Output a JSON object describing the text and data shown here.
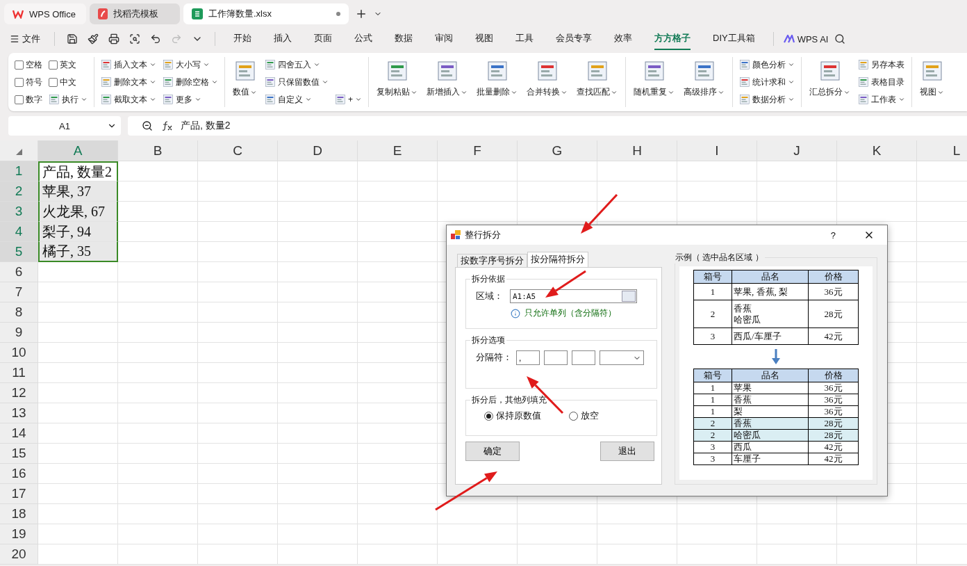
{
  "app_tabs": [
    {
      "kind": "wps",
      "label": "WPS Office",
      "selected": false
    },
    {
      "kind": "template",
      "label": "找稻壳模板",
      "selected": false
    },
    {
      "kind": "sheet",
      "label": "工作簿数量.xlsx",
      "selected": true
    }
  ],
  "menu": {
    "file_label": "文件",
    "tabs": [
      {
        "label": "开始",
        "selected": false
      },
      {
        "label": "插入",
        "selected": false
      },
      {
        "label": "页面",
        "selected": false
      },
      {
        "label": "公式",
        "selected": false
      },
      {
        "label": "数据",
        "selected": false
      },
      {
        "label": "审阅",
        "selected": false
      },
      {
        "label": "视图",
        "selected": false
      },
      {
        "label": "工具",
        "selected": false
      },
      {
        "label": "会员专享",
        "selected": false
      },
      {
        "label": "效率",
        "selected": false
      },
      {
        "label": "方方格子",
        "selected": true
      },
      {
        "label": "DIY工具箱",
        "selected": false
      }
    ],
    "ai_label": "WPS AI"
  },
  "ribbon": {
    "groups": [
      {
        "columns": [
          {
            "items": [
              {
                "kind": "checkbox",
                "label": "空格",
                "checked": false
              },
              {
                "kind": "checkbox",
                "label": "符号",
                "checked": false
              },
              {
                "kind": "checkbox",
                "label": "数字",
                "checked": false
              }
            ]
          },
          {
            "items": [
              {
                "kind": "checkbox",
                "label": "英文",
                "checked": false
              },
              {
                "kind": "checkbox",
                "label": "中文",
                "checked": false
              },
              {
                "kind": "small",
                "label": "执行",
                "dropdown": true
              }
            ]
          }
        ]
      },
      {
        "columns": [
          {
            "items": [
              {
                "kind": "small",
                "label": "插入文本",
                "dropdown": true
              },
              {
                "kind": "small",
                "label": "删除文本",
                "dropdown": true
              },
              {
                "kind": "small",
                "label": "截取文本",
                "dropdown": true
              }
            ]
          },
          {
            "items": [
              {
                "kind": "small",
                "label": "大小写",
                "dropdown": true
              },
              {
                "kind": "small",
                "label": "删除空格",
                "dropdown": true
              },
              {
                "kind": "small",
                "label": "更多",
                "dropdown": true
              }
            ]
          }
        ]
      },
      {
        "columns": [
          {
            "items": [
              {
                "kind": "large",
                "label": "数值",
                "dropdown": true
              }
            ]
          },
          {
            "items": [
              {
                "kind": "small",
                "label": "四舍五入",
                "dropdown": true
              },
              {
                "kind": "small",
                "label": "只保留数值",
                "dropdown": true
              },
              {
                "kind": "small",
                "label": "自定义",
                "dropdown": true
              }
            ]
          },
          {
            "items": [
              {
                "kind": "small",
                "label": "+",
                "dropdown": true
              }
            ]
          }
        ]
      },
      {
        "columns": [
          {
            "items": [
              {
                "kind": "large",
                "label": "复制粘贴",
                "dropdown": true
              }
            ]
          },
          {
            "items": [
              {
                "kind": "large",
                "label": "新增插入",
                "dropdown": true
              }
            ]
          },
          {
            "items": [
              {
                "kind": "large",
                "label": "批量删除",
                "dropdown": true
              }
            ]
          },
          {
            "items": [
              {
                "kind": "large",
                "label": "合并转换",
                "dropdown": true
              }
            ]
          },
          {
            "items": [
              {
                "kind": "large",
                "label": "查找匹配",
                "dropdown": true
              }
            ]
          }
        ]
      },
      {
        "columns": [
          {
            "items": [
              {
                "kind": "large",
                "label": "随机重复",
                "dropdown": true
              }
            ]
          },
          {
            "items": [
              {
                "kind": "large",
                "label": "高级排序",
                "dropdown": true
              }
            ]
          }
        ]
      },
      {
        "columns": [
          {
            "items": [
              {
                "kind": "small",
                "label": "颜色分析",
                "dropdown": true
              },
              {
                "kind": "small",
                "label": "统计求和",
                "dropdown": true
              },
              {
                "kind": "small",
                "label": "数据分析",
                "dropdown": true
              }
            ]
          }
        ]
      },
      {
        "columns": [
          {
            "items": [
              {
                "kind": "large",
                "label": "汇总拆分",
                "dropdown": true
              }
            ]
          },
          {
            "items": [
              {
                "kind": "small",
                "label": "另存本表",
                "dropdown": false
              },
              {
                "kind": "small",
                "label": "表格目录",
                "dropdown": false
              },
              {
                "kind": "small",
                "label": "工作表",
                "dropdown": true
              }
            ]
          }
        ]
      },
      {
        "columns": [
          {
            "items": [
              {
                "kind": "large",
                "label": "视图",
                "dropdown": true
              }
            ]
          }
        ]
      }
    ]
  },
  "formula_bar": {
    "name_box": "A1",
    "formula": "产品, 数量2"
  },
  "sheet": {
    "columns": [
      {
        "label": "A",
        "selected": true
      },
      {
        "label": "B",
        "selected": false
      },
      {
        "label": "C",
        "selected": false
      },
      {
        "label": "D",
        "selected": false
      },
      {
        "label": "E",
        "selected": false
      },
      {
        "label": "F",
        "selected": false
      },
      {
        "label": "G",
        "selected": false
      },
      {
        "label": "H",
        "selected": false
      },
      {
        "label": "I",
        "selected": false
      },
      {
        "label": "J",
        "selected": false
      },
      {
        "label": "K",
        "selected": false
      },
      {
        "label": "L",
        "selected": false
      }
    ],
    "rows": [
      {
        "label": "1",
        "selected": true,
        "cells": [
          {
            "text": "产品, 数量2",
            "selected": true,
            "active": true
          }
        ]
      },
      {
        "label": "2",
        "selected": true,
        "cells": [
          {
            "text": "苹果, 37",
            "selected": true,
            "active": false
          }
        ]
      },
      {
        "label": "3",
        "selected": true,
        "cells": [
          {
            "text": "火龙果, 67",
            "selected": true,
            "active": false
          }
        ]
      },
      {
        "label": "4",
        "selected": true,
        "cells": [
          {
            "text": "梨子, 94",
            "selected": true,
            "active": false
          }
        ]
      },
      {
        "label": "5",
        "selected": true,
        "cells": [
          {
            "text": "橘子, 35",
            "selected": true,
            "active": false
          }
        ]
      },
      {
        "label": "6",
        "selected": false
      },
      {
        "label": "7",
        "selected": false
      },
      {
        "label": "8",
        "selected": false
      },
      {
        "label": "9",
        "selected": false
      },
      {
        "label": "10",
        "selected": false
      },
      {
        "label": "11",
        "selected": false
      },
      {
        "label": "12",
        "selected": false
      },
      {
        "label": "13",
        "selected": false
      },
      {
        "label": "14",
        "selected": false
      },
      {
        "label": "15",
        "selected": false
      },
      {
        "label": "16",
        "selected": false
      },
      {
        "label": "17",
        "selected": false
      },
      {
        "label": "18",
        "selected": false
      },
      {
        "label": "19",
        "selected": false
      },
      {
        "label": "20",
        "selected": false
      }
    ]
  },
  "dialog": {
    "title": "整行拆分",
    "help": "?",
    "tabs": [
      {
        "label": "按数字序号拆分",
        "selected": false
      },
      {
        "label": "按分隔符拆分",
        "selected": true
      }
    ],
    "basis": {
      "legend": "拆分依据",
      "label": "区域：",
      "value": "A1:A5",
      "info": "只允许单列（含分隔符）"
    },
    "options": {
      "legend": "拆分选项",
      "label": "分隔符：",
      "separator": ","
    },
    "fill": {
      "legend": "拆分后，其他列填充",
      "radios": [
        {
          "label": "保持原数值",
          "selected": true
        },
        {
          "label": "放空",
          "selected": false
        }
      ]
    },
    "buttons": [
      "确定",
      "退出"
    ],
    "example": {
      "legend": "示例（ 选中品名区域 ）",
      "before_columns": [
        "箱号",
        "品名",
        "价格"
      ],
      "before": [
        {
          "cells": [
            [
              "1"
            ],
            [
              "苹果, 香蕉, 梨"
            ],
            [
              "36元"
            ]
          ]
        },
        {
          "cells": [
            [
              "2"
            ],
            [
              "香蕉",
              "哈密瓜"
            ],
            [
              "28元"
            ]
          ]
        },
        {
          "cells": [
            [
              "3"
            ],
            [
              "西瓜/车厘子"
            ],
            [
              "42元"
            ]
          ]
        }
      ],
      "after_columns": [
        "箱号",
        "品名",
        "价格"
      ],
      "after": [
        {
          "cells": [
            "1",
            "苹果",
            "36元"
          ],
          "highlighted": false
        },
        {
          "cells": [
            "1",
            "香蕉",
            "36元"
          ],
          "highlighted": false
        },
        {
          "cells": [
            "1",
            "梨",
            "36元"
          ],
          "highlighted": false
        },
        {
          "cells": [
            "2",
            "香蕉",
            "28元"
          ],
          "highlighted": true
        },
        {
          "cells": [
            "2",
            "哈密瓜",
            "28元"
          ],
          "highlighted": true
        },
        {
          "cells": [
            "3",
            "西瓜",
            "42元"
          ],
          "highlighted": false
        },
        {
          "cells": [
            "3",
            "车厘子",
            "42元"
          ],
          "highlighted": false
        }
      ]
    }
  }
}
